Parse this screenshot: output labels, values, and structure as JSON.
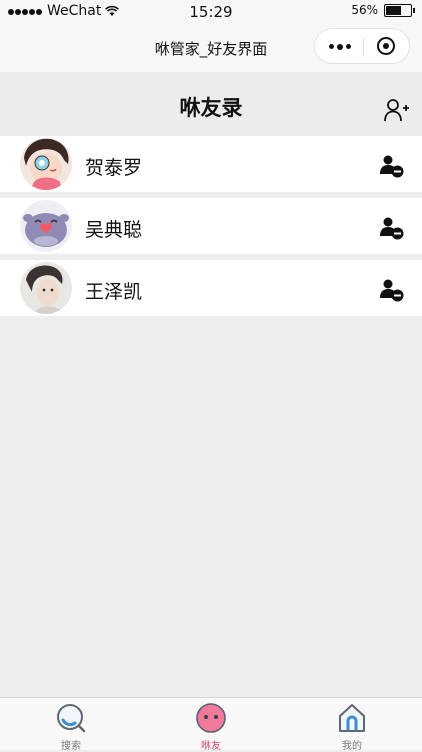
{
  "status_bar": {
    "carrier": "WeChat",
    "time": "15:29",
    "battery": "56%"
  },
  "nav_bar": {
    "title": "咻管家_好友界面"
  },
  "page": {
    "title": "咻友录"
  },
  "friends": [
    {
      "name": "贺泰罗"
    },
    {
      "name": "吴典聪"
    },
    {
      "name": "王泽凯"
    }
  ],
  "tabs": [
    {
      "label": "搜索",
      "icon": "search-icon"
    },
    {
      "label": "咻友",
      "icon": "xiu-friend-icon",
      "active": true
    },
    {
      "label": "我的",
      "icon": "home-icon"
    }
  ],
  "colors": {
    "accent": "#e0476d",
    "background": "#ededed",
    "tab_icon_blue": "#3a8fd8"
  }
}
